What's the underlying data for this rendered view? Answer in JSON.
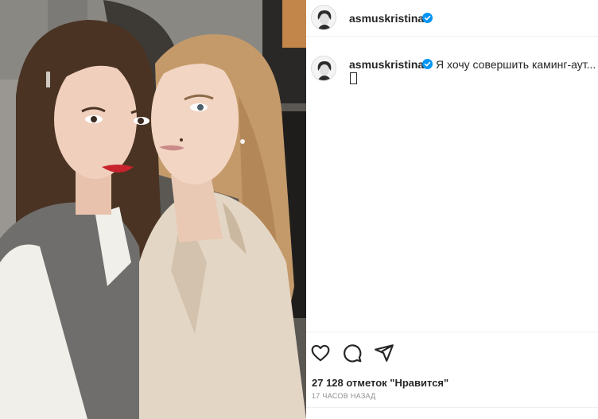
{
  "post": {
    "username": "asmuskristina",
    "caption": {
      "username": "asmuskristina",
      "text": "Я хочу совершить каминг-аут...",
      "emoji": "emoji-glyph"
    },
    "likes_text": "27 128 отметок \"Нравится\"",
    "time_text": "17 ЧАСОВ НАЗАД"
  },
  "icons": {
    "verified": "verified-badge-icon",
    "like": "heart-icon",
    "comment": "comment-icon",
    "share": "share-icon"
  },
  "colors": {
    "verified_blue": "#0095f6",
    "text": "#262626",
    "muted": "#8e8e8e",
    "lipstick": "#c8232c"
  }
}
